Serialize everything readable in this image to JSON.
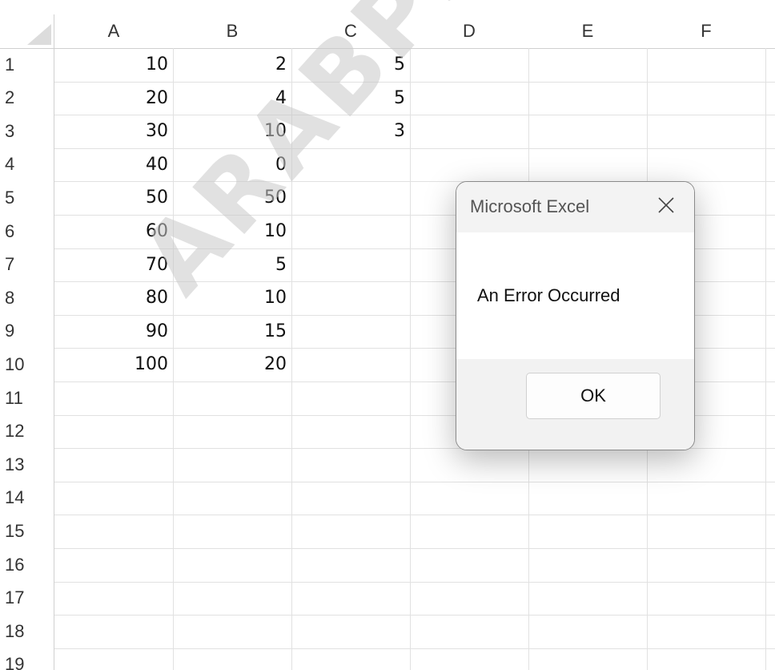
{
  "sheet": {
    "columns": [
      "A",
      "B",
      "C",
      "D",
      "E",
      "F"
    ],
    "rows": [
      "1",
      "2",
      "3",
      "4",
      "5",
      "6",
      "7",
      "8",
      "9",
      "10",
      "11",
      "12",
      "13",
      "14",
      "15",
      "16",
      "17",
      "18",
      "19"
    ],
    "cells": {
      "A": [
        "10",
        "20",
        "30",
        "40",
        "50",
        "60",
        "70",
        "80",
        "90",
        "100"
      ],
      "B": [
        "2",
        "4",
        "10",
        "0",
        "50",
        "10",
        "5",
        "10",
        "15",
        "20"
      ],
      "C": [
        "5",
        "5",
        "3"
      ]
    }
  },
  "watermark": "ARABPSYCHO",
  "dialog": {
    "title": "Microsoft Excel",
    "message": "An Error Occurred",
    "ok_label": "OK",
    "close_icon": "close-icon"
  }
}
